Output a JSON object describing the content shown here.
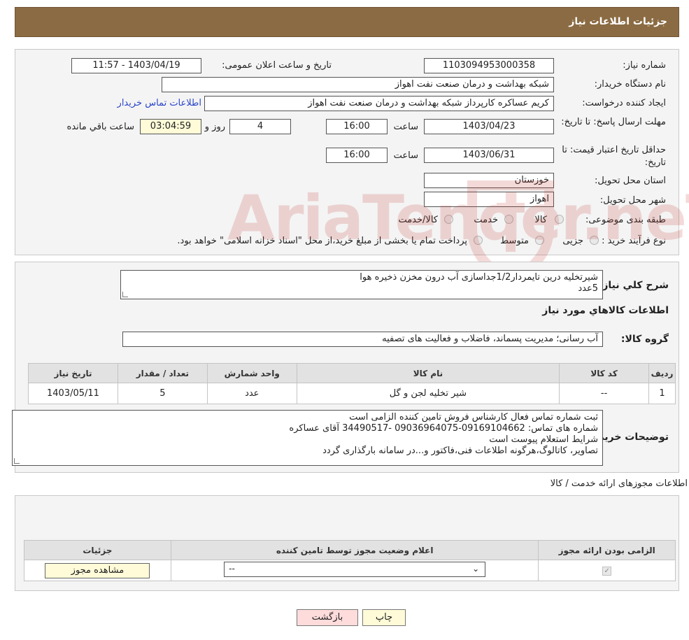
{
  "header": {
    "title": "جزئیات اطلاعات نیاز"
  },
  "need": {
    "number_label": "شماره نیاز:",
    "number": "1103094953000358",
    "announce_label": "تاریخ و ساعت اعلان عمومی:",
    "announce": "1403/04/19 - 11:57",
    "buyer_label": "نام دستگاه خریدار:",
    "buyer": "شبکه بهداشت و درمان صنعت نفت اهواز",
    "creator_label": "ایجاد کننده درخواست:",
    "creator": "کریم عساکره کارپرداز شبکه بهداشت و درمان صنعت نفت اهواز",
    "contact_link": "اطلاعات تماس خریدار",
    "deadline_label": "مهلت ارسال پاسخ: تا تاریخ:",
    "deadline_date": "1403/04/23",
    "time_label": "ساعت",
    "deadline_time": "16:00",
    "days": "4",
    "days_label": "روز و",
    "remaining": "03:04:59",
    "remaining_label": "ساعت باقي مانده",
    "validity_label": "حداقل تاریخ اعتبار قیمت: تا تاریخ:",
    "validity_date": "1403/06/31",
    "validity_time": "16:00",
    "province_label": "استان محل تحویل:",
    "province": "خوزستان",
    "city_label": "شهر محل تحویل:",
    "city": "اهواز",
    "category_label": "طبقه بندی موضوعی:",
    "category_options": [
      "کالا",
      "خدمت",
      "کالا/خدمت"
    ],
    "process_label": "نوع فرآیند خرید :",
    "process_options": [
      "جزیی",
      "متوسط"
    ],
    "process_note": "پرداخت تمام یا بخشی از مبلغ خرید،از محل \"اسناد خزانه اسلامی\" خواهد بود."
  },
  "summary": {
    "desc_label": "شرح کلي نياز:",
    "desc_lines": [
      "شیرتخلیه درین تایمردار1/2جداسازی آب درون مخزن ذخیره هوا",
      "5عدد"
    ],
    "goods_title": "اطلاعات کالاهاي مورد نياز",
    "group_label": "گروه کالا:",
    "group": "آب رسانی؛ مدیریت پسماند، فاضلاب و فعالیت های تصفیه",
    "table_headers": [
      "رديف",
      "کد کالا",
      "نام کالا",
      "واحد شمارش",
      "تعداد / مقدار",
      "تاریخ نیاز"
    ],
    "rows": [
      [
        "1",
        "--",
        "شیر تخلیه لجن و گل",
        "عدد",
        "5",
        "1403/05/11"
      ]
    ],
    "buyer_notes_label": "توضیحات خریدار:",
    "buyer_notes": [
      "ثبت شماره تماس فعال کارشناس فروش تامین کننده الزامی است",
      "شماره های تماس: 09169104662-09036964075 -34490517 آقای عساکره",
      "شرایط استعلام پیوست است",
      "تصاویر، کاتالوگ،هرگونه اطلاعات فنی،فاکتور و...در سامانه بارگذاری گردد"
    ]
  },
  "licenses": {
    "title": "اطلاعات مجوزهای ارائه خدمت / کالا",
    "headers": [
      "الزامی بودن ارائه مجوز",
      "اعلام وضعیت مجوز توسط تامین کننده",
      "جزئیات"
    ],
    "select_value": "--",
    "checkbox_mark": "✓",
    "view_button": "مشاهده مجوز"
  },
  "actions": {
    "print": "چاپ",
    "back": "بازگشت"
  },
  "watermark": {
    "text": "AriaTender.neT"
  },
  "colors": {
    "header_bg": "#8b6b43",
    "link": "#2a44c9",
    "yellow_field": "#fffbd8",
    "back_button": "#ffdcdc"
  }
}
